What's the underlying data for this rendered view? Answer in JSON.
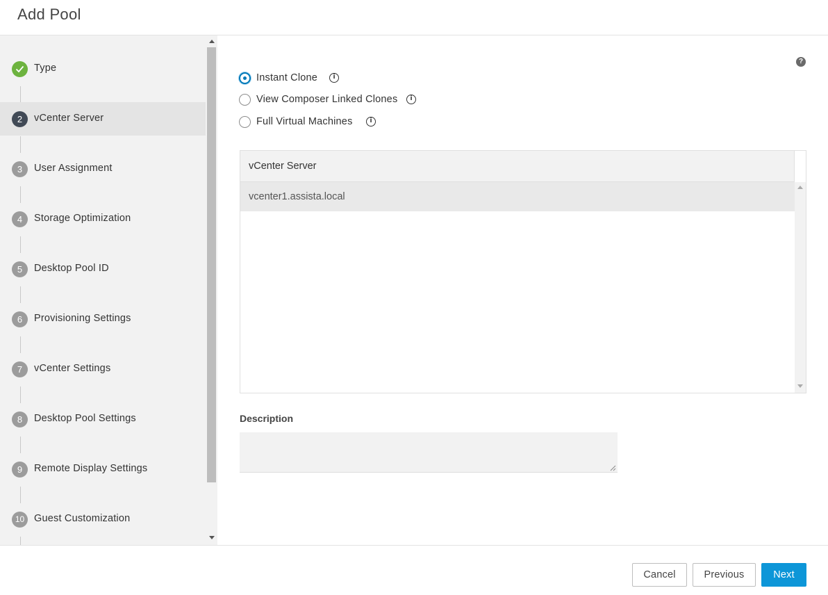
{
  "header": {
    "title": "Add Pool"
  },
  "sidebar": {
    "steps": [
      {
        "num": "1",
        "label": "Type",
        "state": "done"
      },
      {
        "num": "2",
        "label": "vCenter Server",
        "state": "current"
      },
      {
        "num": "3",
        "label": "User Assignment",
        "state": "pending"
      },
      {
        "num": "4",
        "label": "Storage Optimization",
        "state": "pending"
      },
      {
        "num": "5",
        "label": "Desktop Pool ID",
        "state": "pending"
      },
      {
        "num": "6",
        "label": "Provisioning Settings",
        "state": "pending"
      },
      {
        "num": "7",
        "label": "vCenter Settings",
        "state": "pending"
      },
      {
        "num": "8",
        "label": "Desktop Pool Settings",
        "state": "pending"
      },
      {
        "num": "9",
        "label": "Remote Display Settings",
        "state": "pending"
      },
      {
        "num": "10",
        "label": "Guest Customization",
        "state": "pending"
      }
    ]
  },
  "main": {
    "help_icon": "?",
    "clone_options": [
      {
        "label": "Instant Clone",
        "selected": true
      },
      {
        "label": "View Composer Linked Clones",
        "selected": false
      },
      {
        "label": "Full Virtual Machines",
        "selected": false
      }
    ],
    "vcenter_grid": {
      "header": "vCenter Server",
      "rows": [
        "vcenter1.assista.local"
      ]
    },
    "description": {
      "label": "Description",
      "value": ""
    }
  },
  "footer": {
    "cancel_label": "Cancel",
    "previous_label": "Previous",
    "next_label": "Next"
  },
  "colors": {
    "accent": "#0d96d8",
    "done": "#6db33f",
    "current": "#414a56"
  }
}
